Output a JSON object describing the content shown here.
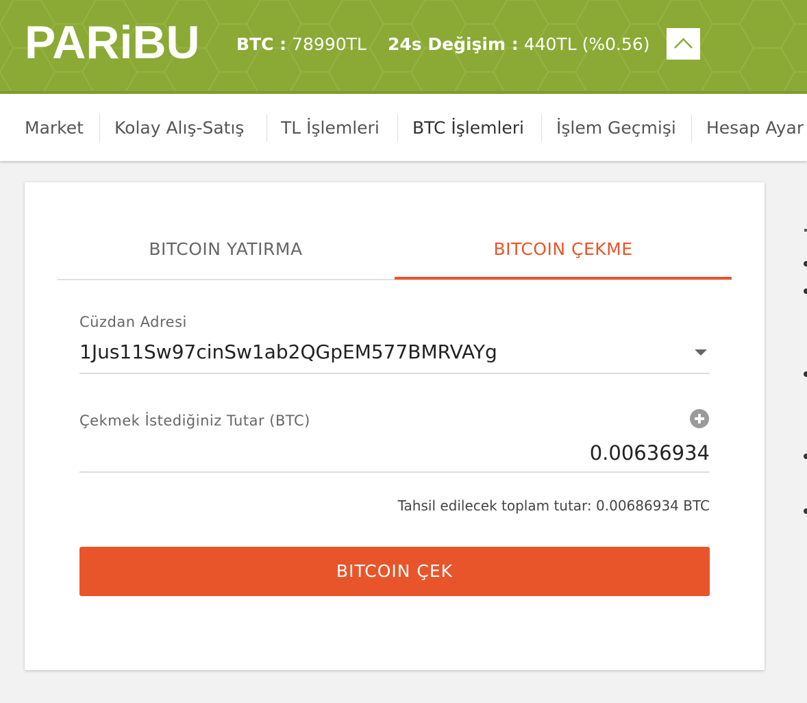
{
  "header": {
    "logo": "PARiBU",
    "btc_label": "BTC :",
    "btc_value": "78990TL",
    "change_label": "24s Değişim :",
    "change_value": "440TL (%0.56)",
    "bg_color": "#8aaa35"
  },
  "nav": {
    "items": [
      {
        "label": "Market"
      },
      {
        "label": "Kolay Alış-Satış"
      },
      {
        "label": "TL İşlemleri"
      },
      {
        "label": "BTC İşlemleri"
      },
      {
        "label": "İşlem Geçmişi"
      },
      {
        "label": "Hesap Ayar"
      }
    ],
    "active": "BTC İşlemleri"
  },
  "tabs": {
    "deposit": "BITCOIN YATIRMA",
    "withdraw": "BITCOIN ÇEKME",
    "active": "BITCOIN ÇEKME"
  },
  "form": {
    "wallet_label": "Cüzdan Adresi",
    "wallet_value": "1Jus11Sw97cinSw1ab2QGpEM577BMRVAYg",
    "amount_label": "Çekmek İstediğiniz Tutar (BTC)",
    "amount_value": "0.00636934",
    "total_text": "Tahsil edilecek toplam tutar: 0.00686934 BTC",
    "submit_label": "BITCOIN ÇEK"
  },
  "colors": {
    "accent": "#e8552a",
    "brand_green": "#8aaa35"
  },
  "icons": {
    "scroll_up": "chevron-up-icon",
    "dropdown": "caret-down-icon",
    "add": "plus-circle-icon"
  }
}
